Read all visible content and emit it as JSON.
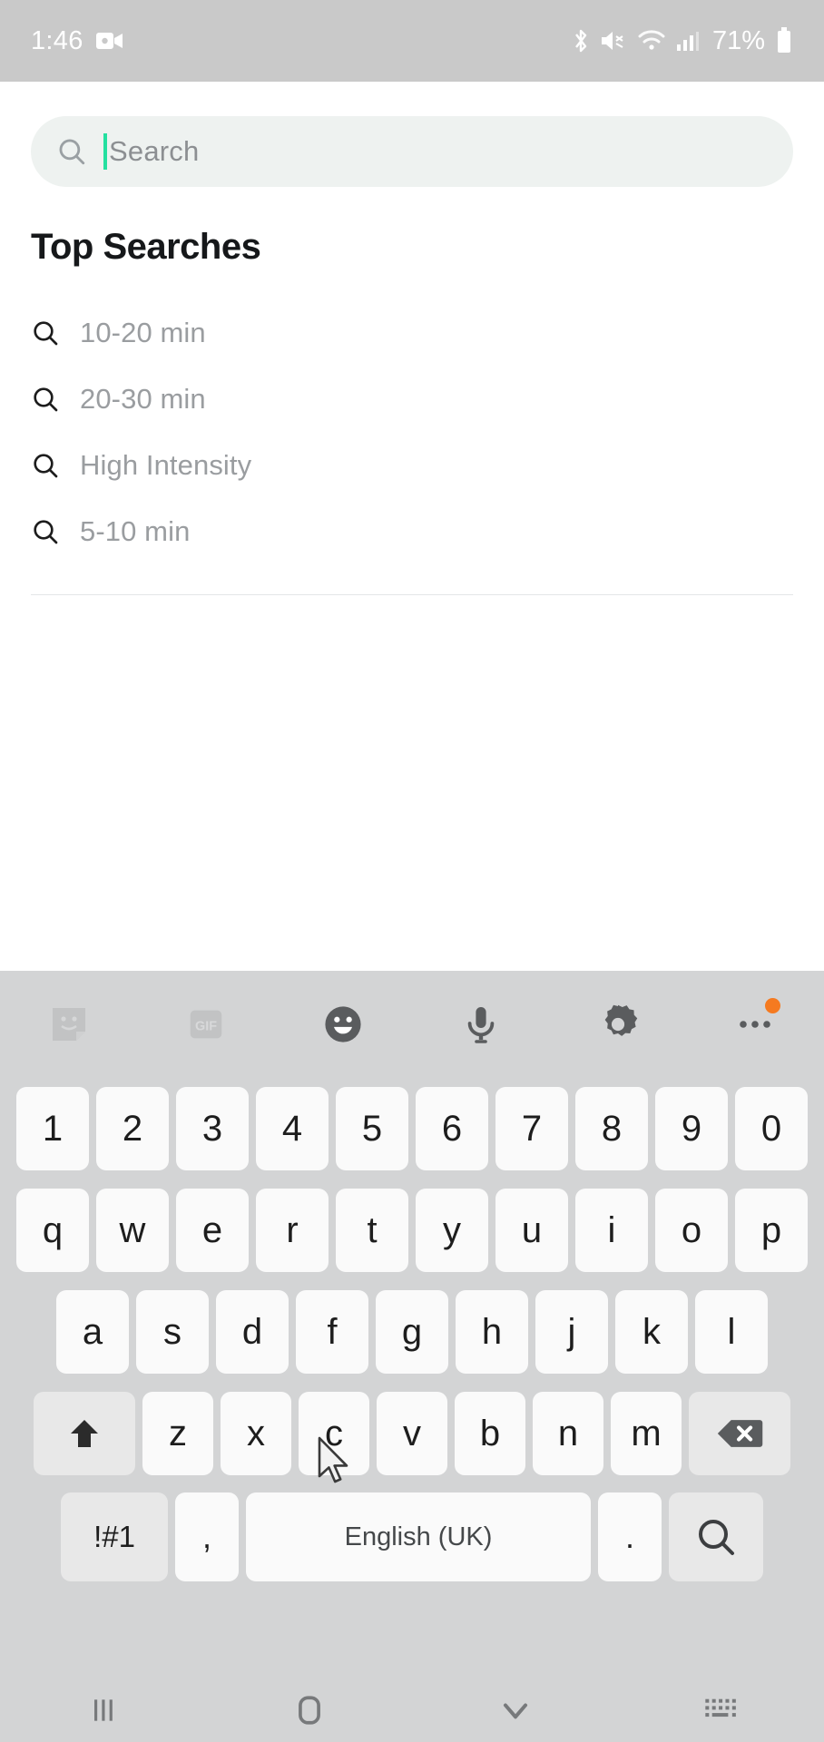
{
  "status_bar": {
    "time": "1:46",
    "battery_percent": "71%",
    "icons": [
      "screen-record-icon",
      "bluetooth-icon",
      "mute-icon",
      "wifi-icon",
      "signal-icon",
      "battery-icon"
    ]
  },
  "search": {
    "placeholder": "Search",
    "value": "",
    "icon": "search-icon",
    "caret_color": "#24e0a0",
    "field_bg": "#eef2f0"
  },
  "top_searches": {
    "title": "Top Searches",
    "items": [
      {
        "label": "10-20 min",
        "icon": "search-icon"
      },
      {
        "label": "20-30 min",
        "icon": "search-icon"
      },
      {
        "label": "High Intensity",
        "icon": "search-icon"
      },
      {
        "label": "5-10 min",
        "icon": "search-icon"
      }
    ]
  },
  "keyboard": {
    "toolbar": [
      {
        "name": "sticker-icon",
        "label": ""
      },
      {
        "name": "gif-icon",
        "label": "GIF"
      },
      {
        "name": "emoji-icon",
        "label": ""
      },
      {
        "name": "microphone-icon",
        "label": ""
      },
      {
        "name": "settings-gear-icon",
        "label": ""
      },
      {
        "name": "more-options-icon",
        "label": "",
        "badge": true
      }
    ],
    "row_numbers": [
      "1",
      "2",
      "3",
      "4",
      "5",
      "6",
      "7",
      "8",
      "9",
      "0"
    ],
    "row_top": [
      "q",
      "w",
      "e",
      "r",
      "t",
      "y",
      "u",
      "i",
      "o",
      "p"
    ],
    "row_home": [
      "a",
      "s",
      "d",
      "f",
      "g",
      "h",
      "j",
      "k",
      "l"
    ],
    "row_bottom": [
      "z",
      "x",
      "c",
      "v",
      "b",
      "n",
      "m"
    ],
    "shift_key": "shift-icon",
    "backspace_key": "backspace-icon",
    "symbols_key": "!#1",
    "comma_key": ",",
    "space_key": "English (UK)",
    "period_key": ".",
    "enter_key": "search-icon",
    "key_bg": "#fafafa",
    "func_key_bg": "#e8e8e8",
    "keyboard_bg": "#d3d4d5",
    "badge_color": "#f57a20"
  },
  "nav_bar": {
    "recents": "recents-icon",
    "home": "home-icon",
    "hide_keyboard": "chevron-down-icon",
    "keyboard_switch": "keyboard-switch-icon"
  }
}
